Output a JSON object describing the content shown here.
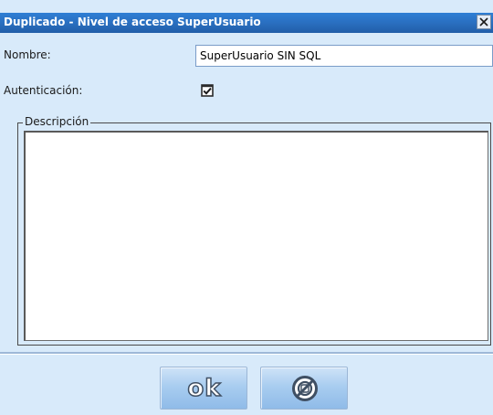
{
  "window": {
    "title": "Duplicado - Nivel de acceso SuperUsuario",
    "close_glyph": "X"
  },
  "form": {
    "name_label": "Nombre:",
    "name_value": "SuperUsuario SIN SQL",
    "auth_label": "Autenticación:",
    "auth_checked": true,
    "description_legend": "Descripción",
    "description_value": ""
  },
  "buttons": {
    "ok_label": "ok",
    "cancel_icon": "cancel-icon"
  },
  "colors": {
    "title_bar": "#2a6fc0",
    "dialog_background": "#d8eafa",
    "button_fill": "#a9cdf0"
  }
}
